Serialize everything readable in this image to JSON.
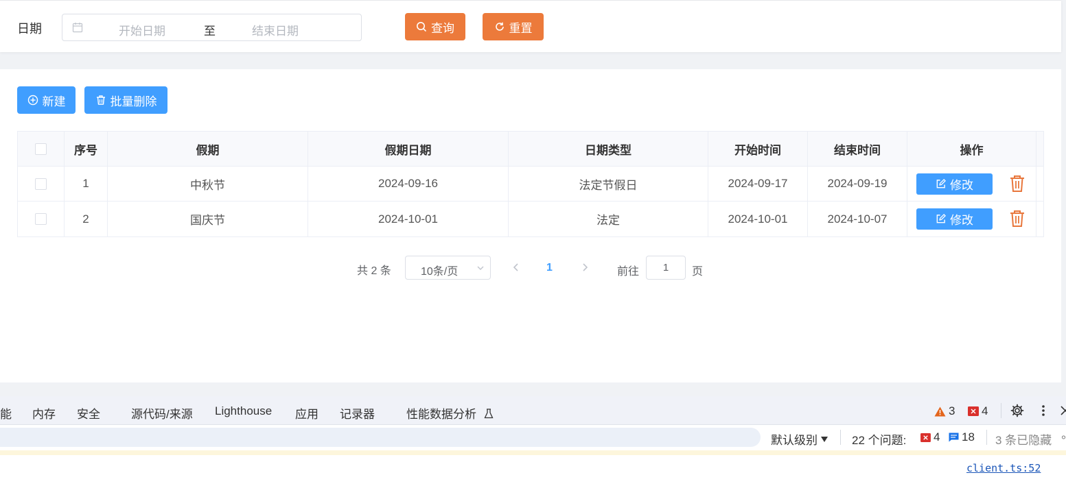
{
  "search": {
    "date_label": "日期",
    "start_placeholder": "开始日期",
    "range_separator": "至",
    "end_placeholder": "结束日期",
    "query_label": "查询",
    "reset_label": "重置"
  },
  "toolbar": {
    "new_label": "新建",
    "batch_delete_label": "批量删除"
  },
  "table": {
    "headers": {
      "index": "序号",
      "holiday": "假期",
      "holiday_date": "假期日期",
      "date_type": "日期类型",
      "start_time": "开始时间",
      "end_time": "结束时间",
      "actions": "操作"
    },
    "rows": [
      {
        "index": "1",
        "holiday": "中秋节",
        "holiday_date": "2024-09-16",
        "date_type": "法定节假日",
        "start_time": "2024-09-17",
        "end_time": "2024-09-19",
        "edit_label": "修改"
      },
      {
        "index": "2",
        "holiday": "国庆节",
        "holiday_date": "2024-10-01",
        "date_type": "法定",
        "start_time": "2024-10-01",
        "end_time": "2024-10-07",
        "edit_label": "修改"
      }
    ]
  },
  "pagination": {
    "total_text": "共 2 条",
    "page_size": "10条/页",
    "current_page": "1",
    "goto_label": "前往",
    "goto_value": "1",
    "page_suffix": "页"
  },
  "devtools": {
    "tabs": [
      "能",
      "内存",
      "安全",
      "源代码/来源",
      "Lighthouse",
      "应用",
      "记录器",
      "性能数据分析"
    ],
    "warning_count": "3",
    "error_count": "4",
    "level_label": "默认级别",
    "issues_label": "22 个问题:",
    "issues_error_count": "4",
    "issues_info_count": "18",
    "hidden_label": "3 条已隐藏",
    "source_link": "client.ts:52"
  },
  "colors": {
    "accent_orange": "#ec7a3b",
    "primary_blue": "#409eff",
    "danger_icon": "#e8763b"
  }
}
